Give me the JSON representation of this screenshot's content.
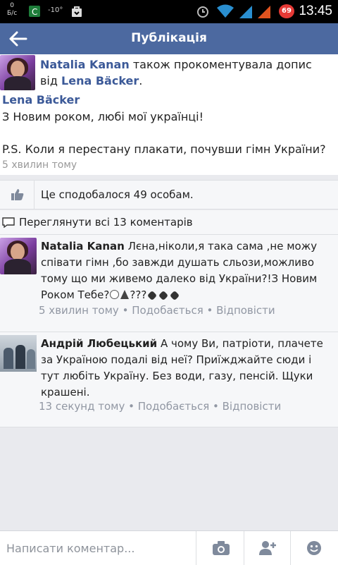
{
  "status_bar": {
    "speed": "0",
    "speed_unit": "Б/с",
    "temperature": "-10°",
    "battery": "69",
    "time": "13:45"
  },
  "header": {
    "title": "Публікація"
  },
  "post": {
    "notification_name": "Natalia Kanan",
    "notification_text": " також прокоментувала допис від ",
    "notification_target": "Lena Bäcker",
    "notification_end": ".",
    "author": "Lena Bäcker",
    "text": "З Новим роком, любі мої українці!\n\nP.S. Коли я перестану плакати, почувши гімн України?",
    "time": "5 хвилин тому"
  },
  "likes": {
    "text": "Це сподобалося 49 особам."
  },
  "view_comments": {
    "text": "Переглянути всі 13 коментарів"
  },
  "comments": [
    {
      "author": "Natalia Kanan",
      "text": " Лєна,ніколи,я така сама ,не можу співати гімн ,бо завжди душать сльози,можливо тому що ми живемо далеко від України?!З Новим Роком Тебе?",
      "text_end": "???",
      "time": "5 хвилин тому",
      "sep": " • ",
      "like_label": "Подобається",
      "reply_label": "Відповісти"
    },
    {
      "author": "Андрій Любецький",
      "text": " А чому Ви, патріоти, плачете за Україною подалі від неї? Приїжджайте сюди і тут любіть Україну. Без води, газу, пенсій. Щуки крашені.",
      "time": "13 секунд тому",
      "sep": " • ",
      "like_label": "Подобається",
      "reply_label": "Відповісти"
    }
  ],
  "compose": {
    "placeholder": "Написати коментар..."
  },
  "colors": {
    "header": "#4c69a0",
    "link": "#3b5998",
    "meta": "#9197a3"
  }
}
